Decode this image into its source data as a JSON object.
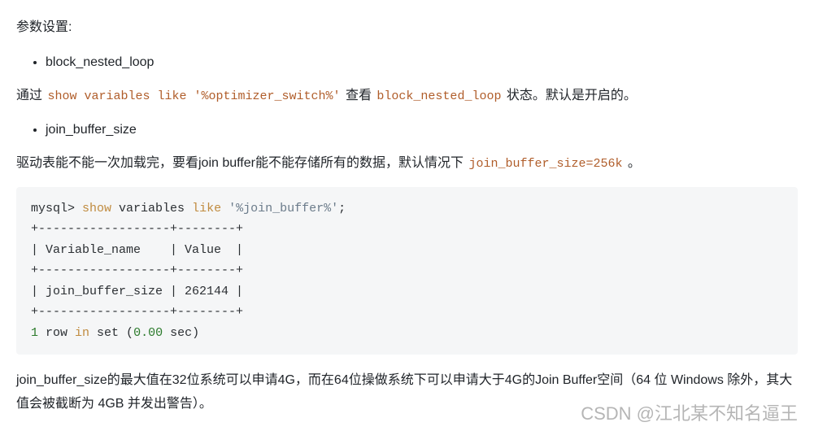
{
  "intro": {
    "heading": "参数设置:"
  },
  "bullets": {
    "item1": "block_nested_loop",
    "item2": "join_buffer_size"
  },
  "para1": {
    "pre": "通过 ",
    "code1": "show variables like '%optimizer_switch%'",
    "mid": " 查看 ",
    "code2": "block_nested_loop",
    "post": " 状态。默认是开启的。"
  },
  "para2": {
    "pre": "驱动表能不能一次加载完，要看join buffer能不能存储所有的数据，默认情况下 ",
    "code1": "join_buffer_size=256k",
    "post": " 。"
  },
  "code": {
    "line1_prefix": "mysql> ",
    "line1_show": "show",
    "line1_vars": " variables ",
    "line1_like": "like",
    "line1_sp": " ",
    "line1_str": "'%join_buffer%'",
    "line1_end": ";",
    "line2": "+------------------+--------+",
    "line3": "| Variable_name    | Value  |",
    "line4": "+------------------+--------+",
    "line5": "| join_buffer_size | 262144 |",
    "line6": "+------------------+--------+",
    "line7_a": "1",
    "line7_b": " row ",
    "line7_c": "in",
    "line7_d": " set (",
    "line7_e": "0.00",
    "line7_f": " sec)"
  },
  "para3": "join_buffer_size的最大值在32位系统可以申请4G，而在64位操做系统下可以申请大于4G的Join Buffer空间（64 位 Windows 除外，其大值会被截断为 4GB 并发出警告）。",
  "watermark": "CSDN @江北某不知名逼王"
}
